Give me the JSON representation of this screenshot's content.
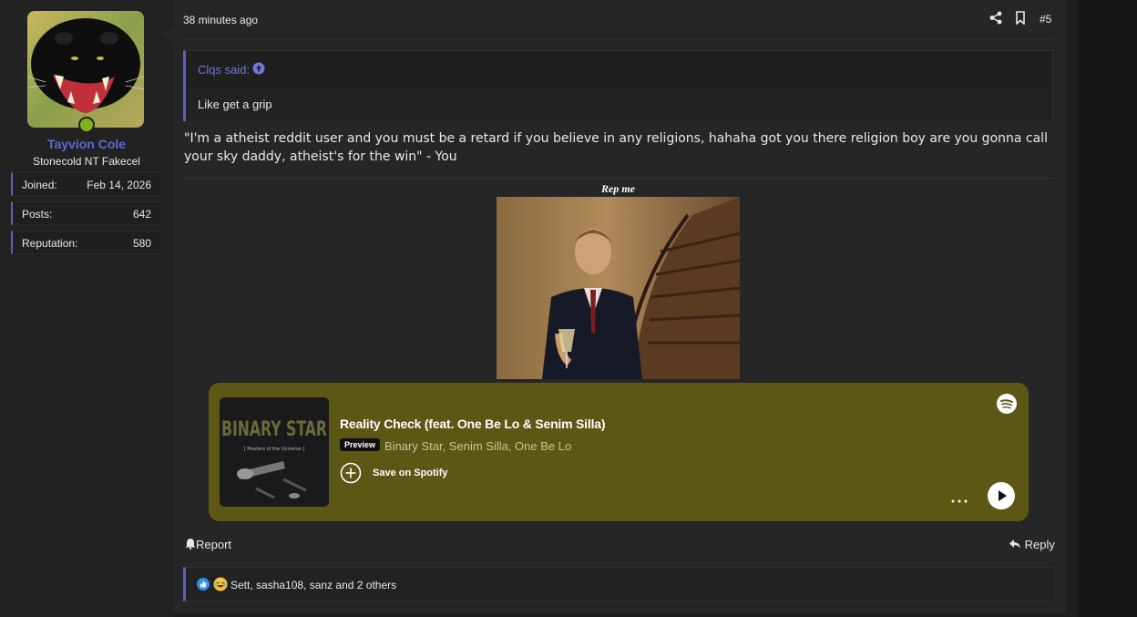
{
  "author": {
    "username": "Tayvion Cole",
    "title": "Stonecold NT Fakecel",
    "stats": [
      {
        "label": "Joined:",
        "value": "Feb 14, 2026"
      },
      {
        "label": "Posts:",
        "value": "642"
      },
      {
        "label": "Reputation:",
        "value": "580"
      }
    ]
  },
  "post": {
    "time": "38 minutes ago",
    "number": "#5",
    "quote": {
      "author": "Clqs said:",
      "text": "Like get a grip"
    },
    "body": "\"I'm a atheist reddit user and you must be a retard if you believe in any religions, hahaha got you there religion boy are you gonna call your sky daddy, atheist's for the win\" - You"
  },
  "signature": {
    "title": "Rep me"
  },
  "spotify": {
    "track": "Reality Check (feat. One Be Lo & Senim Silla)",
    "badge": "Preview",
    "artists": "Binary Star, Senim Silla, One Be Lo",
    "save_label": "Save on Spotify",
    "album_text": "BINARY STAR",
    "album_subtext": "[ Masters of the Universe ]",
    "bg_color": "#5d5716"
  },
  "actions": {
    "report": "Report",
    "reply": "Reply"
  },
  "reactions": {
    "text": "Sett, sasha108, sanz and 2 others"
  },
  "colors": {
    "accent": "#5b5fc7",
    "username": "#5c6bd6",
    "online": "#7cb41c"
  }
}
